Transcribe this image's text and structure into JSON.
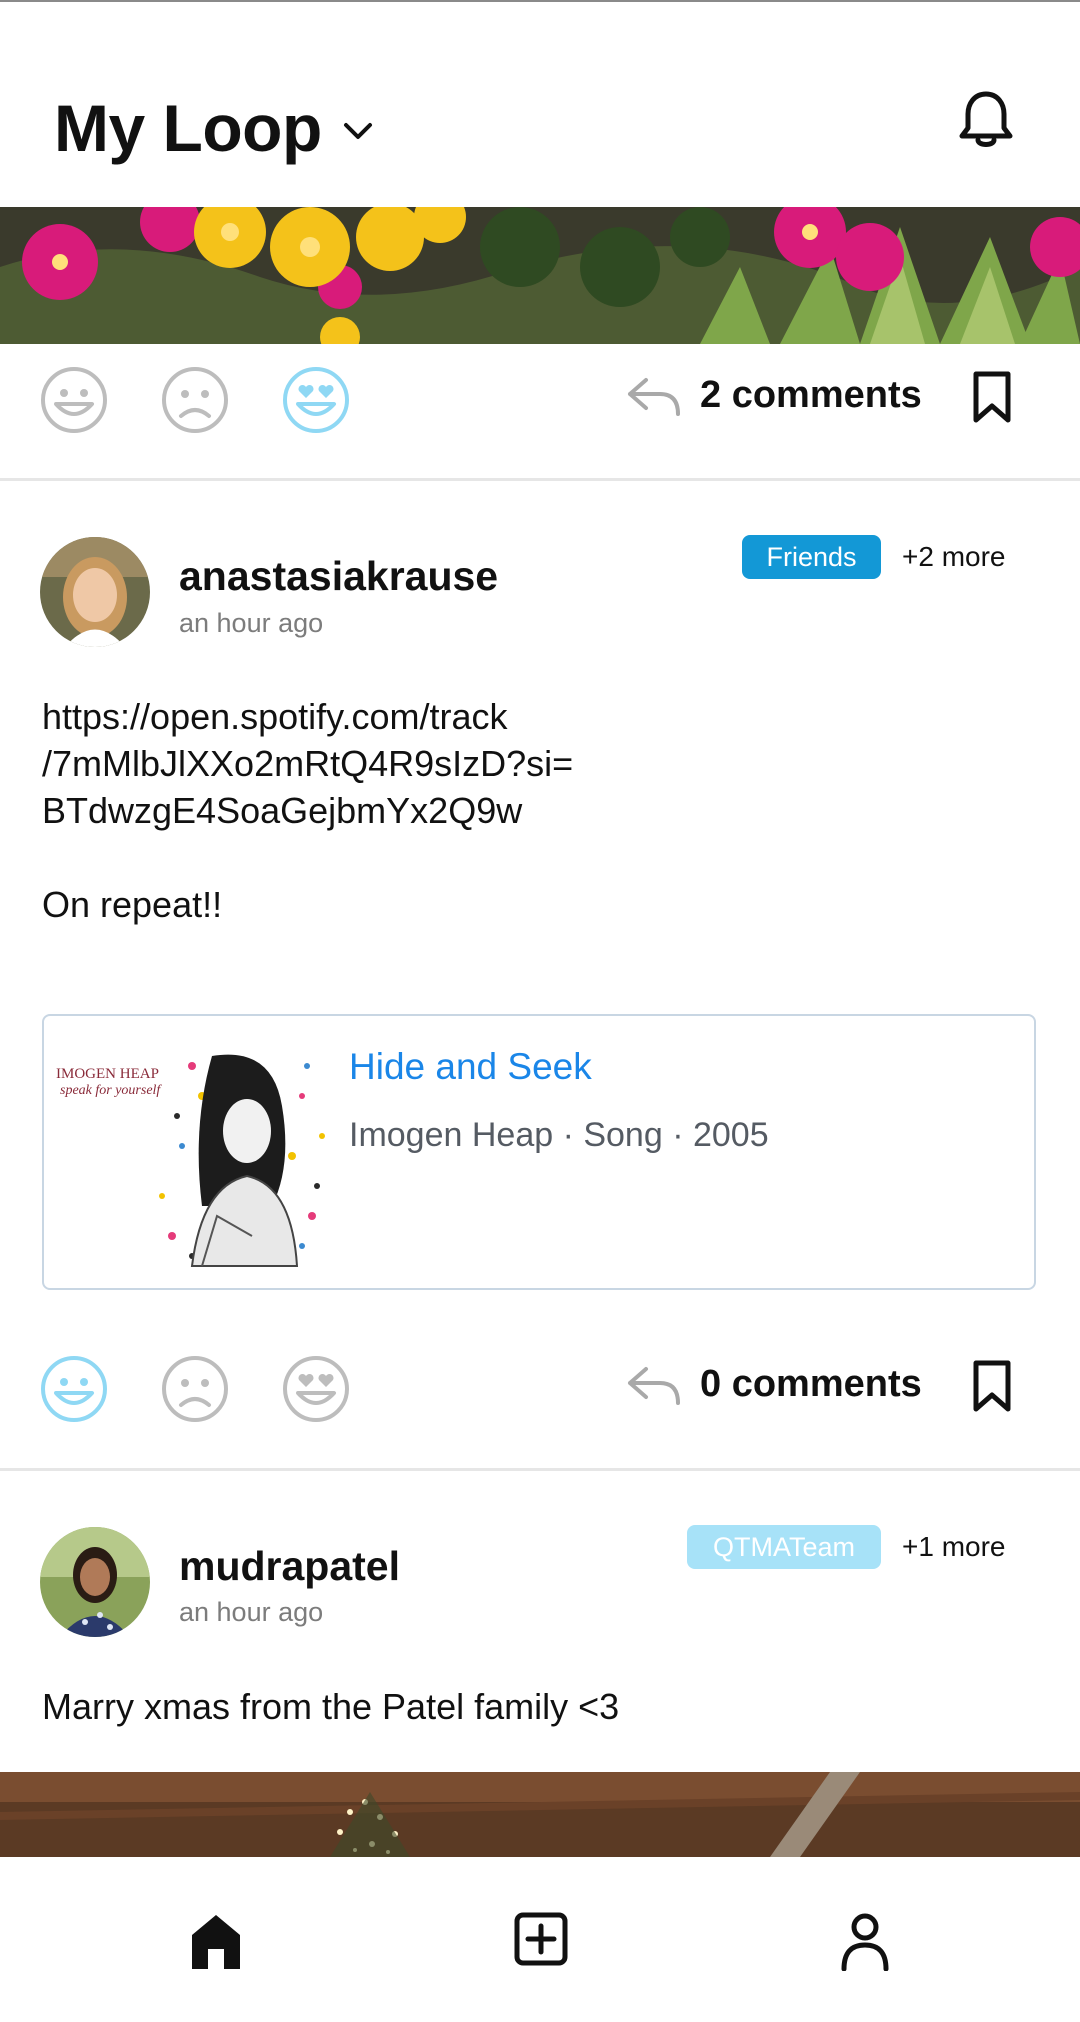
{
  "header": {
    "title": "My Loop"
  },
  "posts": [
    {
      "comments_label": "2 comments"
    },
    {
      "username": "anastasiakrause",
      "time": "an hour ago",
      "tag": "Friends",
      "tag_color": "#1398d6",
      "more": "+2 more",
      "text_lines": [
        "https://open.spotify.com/track",
        "/7mMlbJlXXo2mRtQ4R9sIzD?si=",
        "BTdwzgE4SoaGejbmYx2Q9w",
        "",
        "On repeat!!"
      ],
      "link_card": {
        "title": "Hide and Seek",
        "subtitle": "Imogen Heap · Song · 2005",
        "album_text_1": "IMOGEN HEAP",
        "album_text_2": "speak for yourself"
      },
      "comments_label": "0 comments"
    },
    {
      "username": "mudrapatel",
      "time": "an hour ago",
      "tag": "QTMATeam",
      "tag_color": "#a7e2f8",
      "more": "+1 more",
      "text": "Marry xmas from the Patel family <3"
    }
  ],
  "reactions": {
    "selected_color": "#8fd8f4",
    "unselected_color": "#bdbdbd"
  },
  "icons": [
    "bell-icon",
    "chevron-down-icon",
    "happy-icon",
    "sad-icon",
    "heart-eyes-icon",
    "reply-icon",
    "bookmark-icon",
    "home-icon",
    "add-post-icon",
    "profile-icon"
  ]
}
